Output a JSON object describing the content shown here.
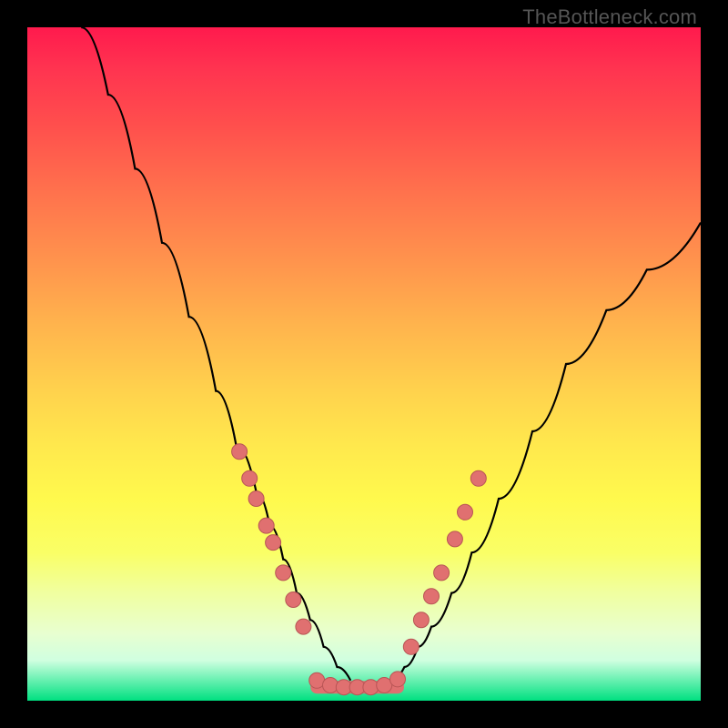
{
  "watermark": "TheBottleneck.com",
  "chart_data": {
    "type": "line",
    "title": "",
    "xlabel": "",
    "ylabel": "",
    "xlim": [
      0,
      100
    ],
    "ylim": [
      0,
      100
    ],
    "grid": false,
    "legend": false,
    "curve_left": {
      "name": "left-branch",
      "x": [
        8,
        12,
        16,
        20,
        24,
        28,
        31,
        34,
        36,
        38,
        40,
        42,
        44,
        46,
        48
      ],
      "y": [
        100,
        90,
        79,
        68,
        57,
        46,
        38,
        31,
        26,
        21,
        16,
        12,
        8,
        5,
        3
      ]
    },
    "curve_right": {
      "name": "right-branch",
      "x": [
        54,
        56,
        58,
        60,
        63,
        66,
        70,
        75,
        80,
        86,
        92,
        100
      ],
      "y": [
        3,
        5,
        8,
        11,
        16,
        22,
        30,
        40,
        50,
        58,
        64,
        71
      ]
    },
    "flat_segment": {
      "name": "trough",
      "x": [
        43,
        46,
        49,
        52,
        55
      ],
      "y": [
        2,
        2,
        2,
        2,
        2
      ]
    },
    "series": [
      {
        "name": "dots-left",
        "x": [
          31.5,
          33.0,
          34.0,
          35.5,
          36.5,
          38.0,
          39.5,
          41.0
        ],
        "y": [
          37.0,
          33.0,
          30.0,
          26.0,
          23.5,
          19.0,
          15.0,
          11.0
        ]
      },
      {
        "name": "dots-trough",
        "x": [
          43.0,
          45.0,
          47.0,
          49.0,
          51.0,
          53.0,
          55.0
        ],
        "y": [
          3.0,
          2.3,
          2.0,
          2.0,
          2.0,
          2.3,
          3.2
        ]
      },
      {
        "name": "dots-right",
        "x": [
          57.0,
          58.5,
          60.0,
          61.5,
          63.5,
          65.0,
          67.0
        ],
        "y": [
          8.0,
          12.0,
          15.5,
          19.0,
          24.0,
          28.0,
          33.0
        ]
      }
    ]
  }
}
